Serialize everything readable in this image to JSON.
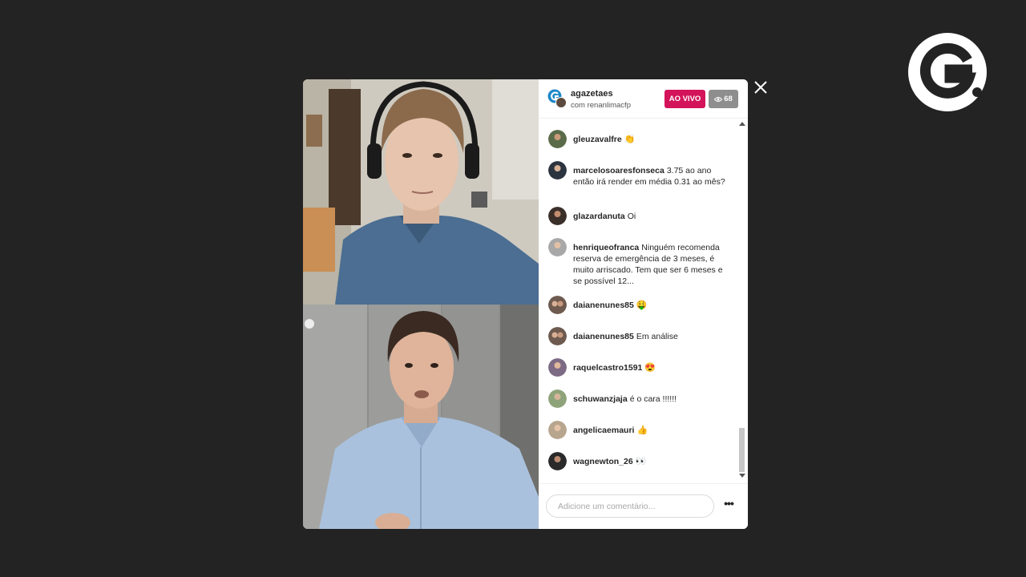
{
  "stream": {
    "host": "agazetaes",
    "with_label": "com renanlimacfp",
    "live_label": "AO VIVO",
    "viewer_count": "68",
    "live_color": "#d3145a"
  },
  "comments": [
    {
      "user": "gleuzavalfre",
      "text": "",
      "emoji": "👏"
    },
    {
      "user": "marcelosoaresfonseca",
      "text": "3.75 ao ano então irá render em média 0.31 ao mês?",
      "emoji": ""
    },
    {
      "user": "glazardanuta",
      "text": "Oi",
      "emoji": ""
    },
    {
      "user": "henriqueofranca",
      "text": "Ninguém recomenda reserva de emergência de 3 meses, é muito arriscado. Tem que ser 6 meses e se possível 12...",
      "emoji": ""
    },
    {
      "user": "daianenunes85",
      "text": "",
      "emoji": "🤑"
    },
    {
      "user": "daianenunes85",
      "text": "Em análise",
      "emoji": ""
    },
    {
      "user": "raquelcastro1591",
      "text": "",
      "emoji": "😍"
    },
    {
      "user": "schuwanzjaja",
      "text": "é o cara !!!!!!",
      "emoji": ""
    },
    {
      "user": "angelicaemauri",
      "text": "",
      "emoji": "👍"
    },
    {
      "user": "wagnewton_26",
      "text": "",
      "emoji": "👀"
    }
  ],
  "composer": {
    "placeholder": "Adicione um comentário...",
    "more_label": "•••"
  },
  "icons": {
    "close": "close-icon",
    "logo": "g-logo-icon",
    "eye": "eye-icon"
  }
}
